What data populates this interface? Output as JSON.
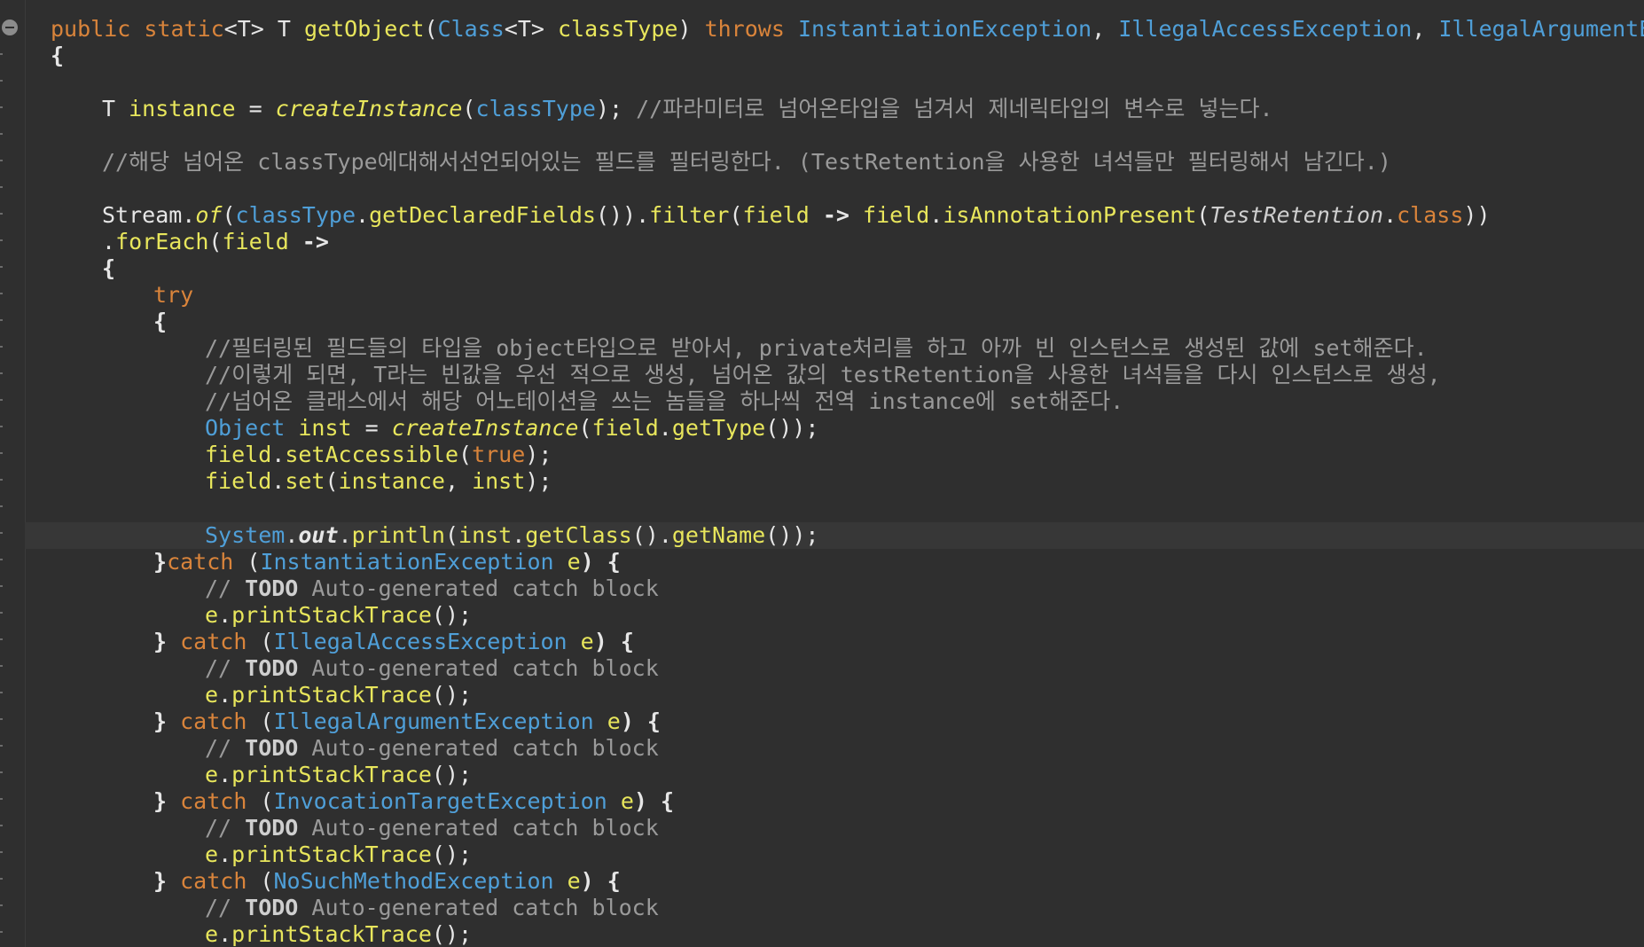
{
  "editor": {
    "language": "java",
    "colors": {
      "background": "#2f2f2f",
      "keyword": "#d9843b",
      "type": "#4f9fd8",
      "method": "#e8e65c",
      "comment": "#9a9a9a",
      "text": "#e6e6e6"
    },
    "fold_icon": "collapse-minus-icon"
  },
  "code": {
    "l1": {
      "a": "public static",
      "b": "<T> T ",
      "c": "getObject",
      "d": "(",
      "e": "Class",
      "f": "<T> ",
      "g": "classType",
      "h": ") ",
      "i": "throws ",
      "j": "InstantiationException",
      ",": ", ",
      "k": "IllegalAccessException",
      "l": ", ",
      "m": "IllegalArgumentExcep"
    },
    "l2": "{",
    "l3": {
      "a": "T ",
      "b": "instance",
      "c": " = ",
      "d": "createInstance",
      "e": "(",
      "f": "classType",
      "g": "); ",
      "h": "//파라미터로 넘어온타입을 넘겨서 제네릭타입의 변수로 넣는다."
    },
    "l4": "//해당 넘어온 classType에대해서선언되어있는 필드를 필터링한다. (TestRetention을 사용한 녀석들만 필터링해서 남긴다.)",
    "l5": {
      "a": "Stream.",
      "b": "of",
      "c": "(",
      "d": "classType",
      "e": ".",
      "f": "getDeclaredFields",
      "g": "()).",
      "h": "filter",
      "i": "(",
      "j": "field",
      "k": " -> ",
      "l": "field",
      "m": ".",
      "n": "isAnnotationPresent",
      "o": "(",
      "p": "TestRetention",
      "q": ".",
      "r": "class",
      "s": "))"
    },
    "l6": {
      "a": ".",
      "b": "forEach",
      "c": "(",
      "d": "field",
      "e": " ->"
    },
    "l7": "{",
    "l8": "try",
    "l9": "{",
    "l10": "//필터링된 필드들의 타입을 object타입으로 받아서, private처리를 하고 아까 빈 인스턴스로 생성된 값에 set해준다.",
    "l11": "//이렇게 되면, T라는 빈값을 우선 적으로 생성, 넘어온 값의 testRetention을 사용한 녀석들을 다시 인스턴스로 생성,",
    "l12": "//넘어온 클래스에서 해당 어노테이션을 쓰는 놈들을 하나씩 전역 instance에 set해준다.",
    "l13": {
      "a": "Object ",
      "b": "inst",
      "c": " = ",
      "d": "createInstance",
      "e": "(",
      "f": "field",
      "g": ".",
      "h": "getType",
      "i": "());"
    },
    "l14": {
      "a": "field",
      "b": ".",
      "c": "setAccessible",
      "d": "(",
      "e": "true",
      "f": ");"
    },
    "l15": {
      "a": "field",
      "b": ".",
      "c": "set",
      "d": "(",
      "e": "instance",
      ",": ", ",
      "f": "inst",
      "g": ");"
    },
    "l17": {
      "a": "System",
      "b": ".",
      "c": "out",
      "d": ".",
      "e": "println",
      "f": "(",
      "g": "inst",
      "h": ".",
      "i": "getClass",
      "j": "().",
      "k": "getName",
      "l": "());"
    },
    "catches": [
      {
        "close": "}",
        "kw": "catch",
        "open": " (",
        "type": "InstantiationException",
        "var": " e",
        "end": ") {"
      },
      {
        "close": "} ",
        "kw": "catch",
        "open": " (",
        "type": "IllegalAccessException",
        "var": " e",
        "end": ") {"
      },
      {
        "close": "} ",
        "kw": "catch",
        "open": " (",
        "type": "IllegalArgumentException",
        "var": " e",
        "end": ") {"
      },
      {
        "close": "} ",
        "kw": "catch",
        "open": " (",
        "type": "InvocationTargetException",
        "var": " e",
        "end": ") {"
      },
      {
        "close": "} ",
        "kw": "catch",
        "open": " (",
        "type": "NoSuchMethodException",
        "var": " e",
        "end": ") {"
      }
    ],
    "todo": {
      "slashes": "// ",
      "todo": "TODO",
      "rest": " Auto-generated catch block"
    },
    "print": {
      "a": "e",
      "b": ".",
      "c": "printStackTrace",
      "d": "();"
    }
  }
}
